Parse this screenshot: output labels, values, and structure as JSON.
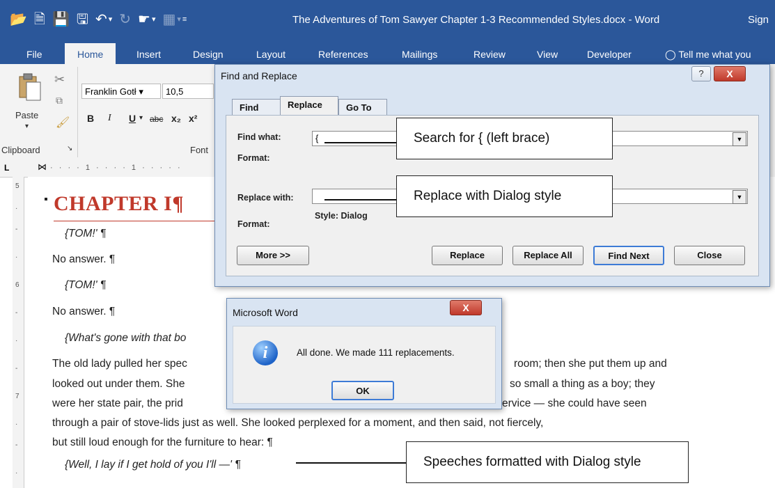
{
  "app": {
    "window_title": "The Adventures of Tom Sawyer Chapter 1-3 Recommended Styles.docx  -  Word",
    "signin": "Sign",
    "tabs": [
      "File",
      "Home",
      "Insert",
      "Design",
      "Layout",
      "References",
      "Mailings",
      "Review",
      "View",
      "Developer"
    ],
    "tell_me": "Tell me what you",
    "qat_icons": [
      "folder-icon",
      "new-document-icon",
      "save-icon",
      "save-as-icon",
      "undo-icon",
      "redo-icon",
      "touch-mode-icon",
      "table-icon",
      "customize-icon"
    ]
  },
  "ribbon": {
    "paste_label": "Paste",
    "clipboard_label": "Clipboard",
    "font_label": "Font",
    "font_name": "Franklin Gotł",
    "font_size": "10,5",
    "format_buttons": [
      "B",
      "I",
      "U",
      "abc",
      "x₂",
      "x²"
    ]
  },
  "document": {
    "chapter_heading": "CHAPTER I¶",
    "paragraphs": [
      "{TOM!' ¶",
      "No answer. ¶",
      "{TOM!' ¶",
      "No answer. ¶",
      "{What's gone with that bo",
      "The old lady pulled her spec",
      "looked out under them. She",
      "were her state pair, the prid",
      "through a pair of stove-lids just as well. She looked perplexed for a moment, and then said, not fiercely,",
      "but still loud enough for the furniture to hear: ¶",
      "{Well, I lay if I get hold of you I'll —' ¶"
    ],
    "paragraph_tails": {
      "line6": "room; then she put them up and",
      "line7": "so small a thing as a boy; they",
      "line8": "ervice — she could have seen"
    }
  },
  "find_replace": {
    "title": "Find and Replace",
    "help": "?",
    "close_glyph": "X",
    "tabs": [
      "Find",
      "Replace",
      "Go To"
    ],
    "find_what_label": "Find what:",
    "find_what_value": "{",
    "format_label": "Format:",
    "replace_with_label": "Replace with:",
    "replace_with_value": "",
    "replace_format_label": "Format:",
    "replace_format_value": "Style: Dialog",
    "buttons": {
      "more": "More >>",
      "replace": "Replace",
      "replace_all": "Replace All",
      "find_next": "Find Next",
      "close": "Close"
    }
  },
  "message_box": {
    "title": "Microsoft Word",
    "close_glyph": "X",
    "message": "All done. We made 111 replacements.",
    "ok": "OK"
  },
  "callouts": {
    "search": "Search for { (left brace)",
    "replace": "Replace with Dialog style",
    "speeches": "Speeches formatted with Dialog style"
  }
}
